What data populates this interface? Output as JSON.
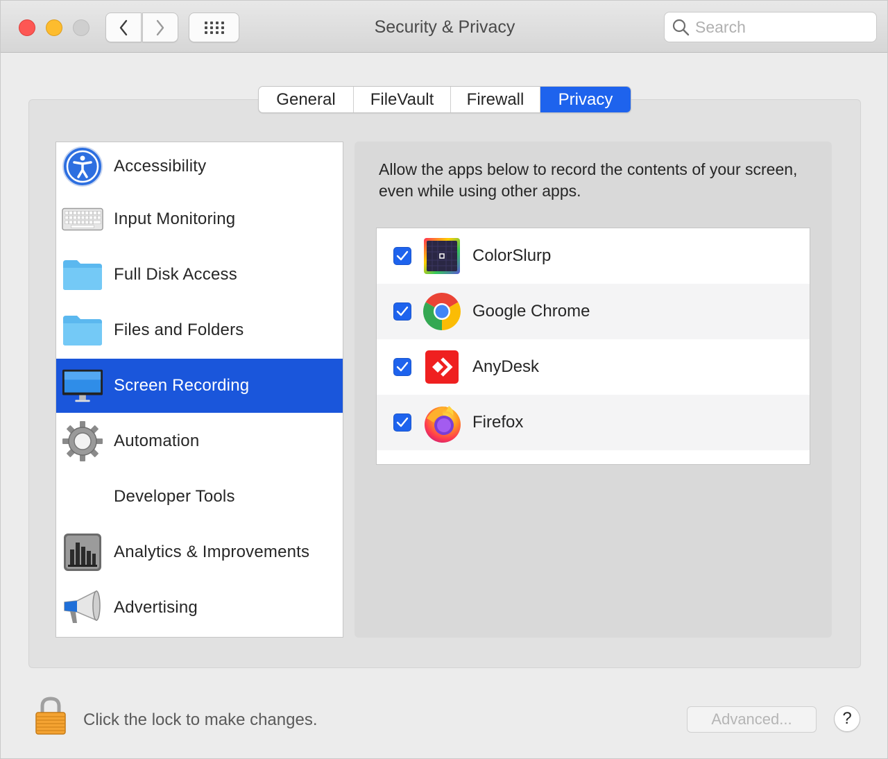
{
  "window": {
    "title": "Security & Privacy"
  },
  "search": {
    "placeholder": "Search",
    "value": ""
  },
  "tabs": [
    {
      "label": "General"
    },
    {
      "label": "FileVault"
    },
    {
      "label": "Firewall"
    },
    {
      "label": "Privacy",
      "active": true
    }
  ],
  "sidebar": {
    "items": [
      {
        "label": "Accessibility",
        "icon": "accessibility-icon"
      },
      {
        "label": "Input Monitoring",
        "icon": "keyboard-icon"
      },
      {
        "label": "Full Disk Access",
        "icon": "folder-icon"
      },
      {
        "label": "Files and Folders",
        "icon": "folder-icon"
      },
      {
        "label": "Screen Recording",
        "icon": "display-icon",
        "selected": true
      },
      {
        "label": "Automation",
        "icon": "gear-icon"
      },
      {
        "label": "Developer Tools",
        "icon": ""
      },
      {
        "label": "Analytics & Improvements",
        "icon": "bar-chart-icon"
      },
      {
        "label": "Advertising",
        "icon": "megaphone-icon"
      }
    ]
  },
  "panel": {
    "description": "Allow the apps below to record the contents of your screen, even while using other apps.",
    "apps": [
      {
        "name": "ColorSlurp",
        "checked": true,
        "icon": "colorslurp-icon"
      },
      {
        "name": "Google Chrome",
        "checked": true,
        "icon": "chrome-icon"
      },
      {
        "name": "AnyDesk",
        "checked": true,
        "icon": "anydesk-icon"
      },
      {
        "name": "Firefox",
        "checked": true,
        "icon": "firefox-icon"
      }
    ]
  },
  "footer": {
    "lock_text": "Click the lock to make changes.",
    "advanced_label": "Advanced...",
    "help_label": "?"
  },
  "colors": {
    "accent": "#1e63ed",
    "selection": "#1a56db"
  }
}
